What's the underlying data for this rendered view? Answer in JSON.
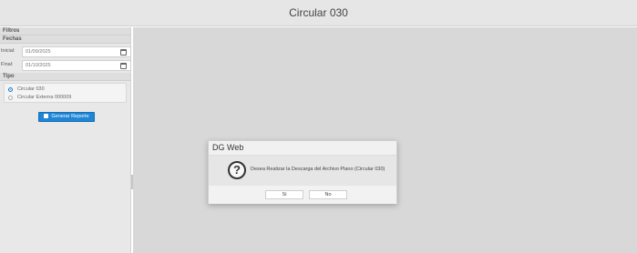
{
  "window": {
    "title": "Circular 030"
  },
  "sidebar": {
    "filters_label": "Filtros",
    "dates_label": "Fechas",
    "start": {
      "label": "Inicial:",
      "value": "01/09/2025"
    },
    "end": {
      "label": "Final:",
      "value": "01/10/2025"
    },
    "type_label": "Tipo",
    "options": [
      {
        "label": "Circular 030",
        "selected": true
      },
      {
        "label": "Circular Externa 000009",
        "selected": false
      }
    ],
    "generate_label": "Generar Reporte"
  },
  "dialog": {
    "title": "DG Web",
    "message": "Desea Realizar la Descarga del Archivo Plano (Circular 030)",
    "yes_label": "Si",
    "no_label": "No"
  },
  "colors": {
    "accent": "#1f86d6",
    "background": "#d8d8d8"
  }
}
